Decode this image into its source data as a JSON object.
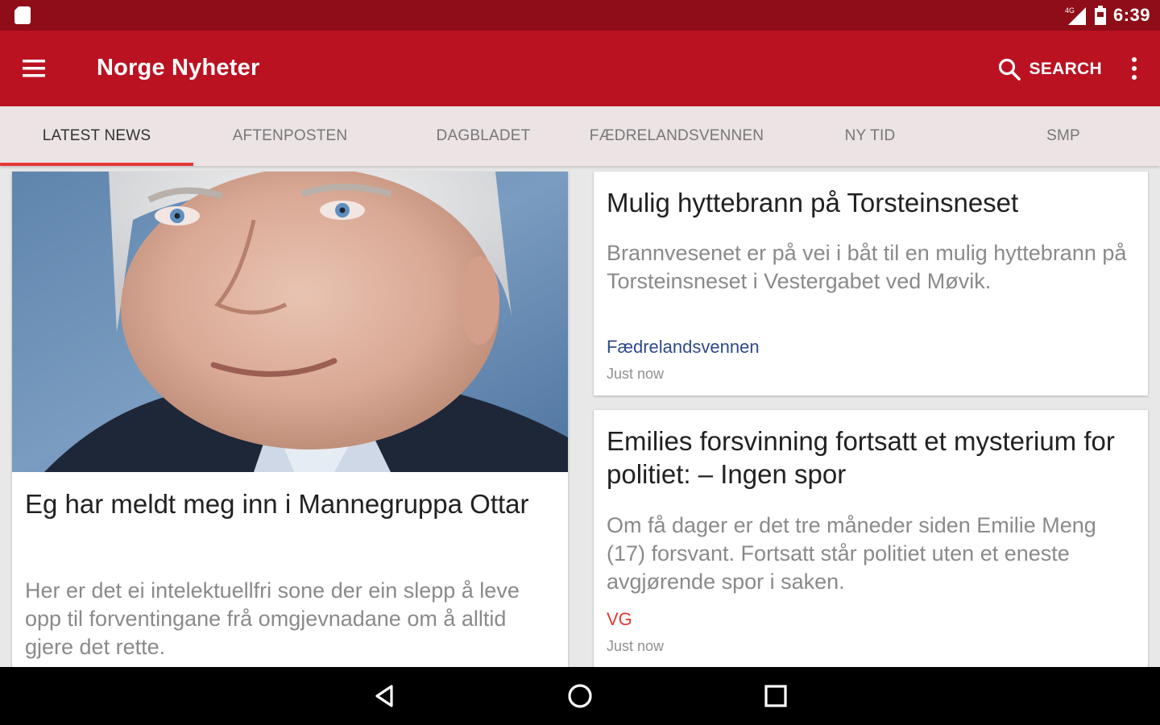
{
  "status_bar": {
    "network": "4G",
    "time": "6:39"
  },
  "app_bar": {
    "title": "Norge Nyheter",
    "search_label": "SEARCH"
  },
  "tabs": [
    {
      "label": "LATEST NEWS",
      "active": true
    },
    {
      "label": "AFTENPOSTEN",
      "active": false
    },
    {
      "label": "DAGBLADET",
      "active": false
    },
    {
      "label": "FÆDRELANDSVENNEN",
      "active": false
    },
    {
      "label": "NY TID",
      "active": false
    },
    {
      "label": "SMP",
      "active": false
    }
  ],
  "articles": [
    {
      "headline": "Eg har meldt meg inn i Mannegruppa Ottar",
      "summary": "Her er det ei intelektuellfri sone der ein slepp å leve opp til forventingane frå omgjevnadane om å alltid gjere det rette.",
      "has_photo": true
    },
    {
      "headline": "Mulig hyttebrann på Torsteinsneset",
      "summary": "Brannvesenet er på vei i båt til en mulig hyttebrann på Torsteinsneset i Vestergabet ved Møvik.",
      "source": "Fædrelandsvennen",
      "source_color": "#2f4a8a",
      "time": "Just now"
    },
    {
      "headline": "Emilies forsvinning fortsatt et mysterium for politiet: – Ingen spor",
      "summary": "Om få dager er det tre måneder siden Emilie Meng (17) forsvant. Fortsatt står politiet uten et eneste avgjørende spor i saken.",
      "source": "VG",
      "source_color": "#e53935",
      "time": "Just now"
    }
  ],
  "colors": {
    "status_bar": "#8e0d18",
    "app_bar": "#bb1222",
    "tab_bar": "#ebe3e4",
    "tab_indicator": "#e53935"
  },
  "icons": [
    "sd-card-icon",
    "signal-icon",
    "battery-icon",
    "menu-icon",
    "search-icon",
    "more-vert-icon",
    "back-icon",
    "home-icon",
    "recents-icon"
  ]
}
